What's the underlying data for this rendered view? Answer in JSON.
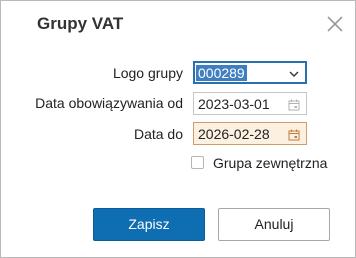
{
  "dialog": {
    "title": "Grupy VAT",
    "close_icon": "close-icon"
  },
  "form": {
    "logo_group": {
      "label": "Logo grupy",
      "value": "000289",
      "icon": "chevron-down-icon"
    },
    "valid_from": {
      "label": "Data obowiązywania od",
      "value": "2023-03-01",
      "icon": "calendar-icon"
    },
    "date_to": {
      "label": "Data do",
      "value": "2026-02-28",
      "icon": "calendar-icon"
    },
    "external_group": {
      "label": "Grupa zewnętrzna",
      "checked": false
    }
  },
  "buttons": {
    "save": "Zapisz",
    "cancel": "Anuluj"
  },
  "colors": {
    "primary": "#0f6db2",
    "focus_border": "#2a6fb0",
    "selection": "#3f7fc0",
    "date_highlight_bg": "#fcf1e0",
    "date_highlight_border": "#d39a6a"
  }
}
